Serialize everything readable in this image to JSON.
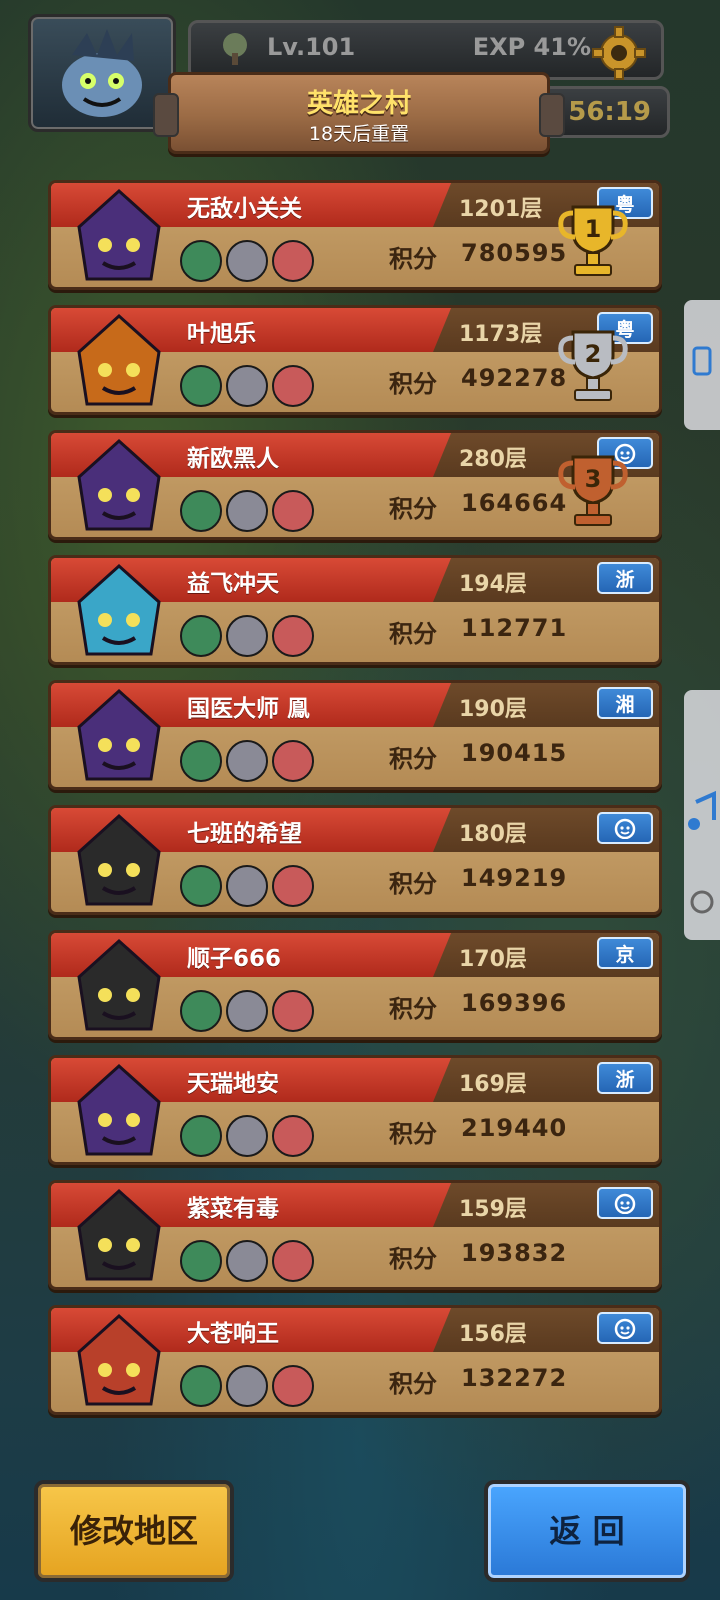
{
  "header": {
    "level": "Lv.101",
    "exp": "EXP 41%",
    "timer": "56:19",
    "banner_title": "英雄之村",
    "banner_subtitle": "18天后重置"
  },
  "leaderboard": {
    "score_label": "积分",
    "rows": [
      {
        "name": "无敌小关关",
        "floor": "1201层",
        "score": "780595",
        "region": "粤",
        "trophy": "gold"
      },
      {
        "name": "叶旭乐",
        "floor": "1173层",
        "score": "492278",
        "region": "粤",
        "trophy": "silver"
      },
      {
        "name": "新欧黑人",
        "floor": "280层",
        "score": "164664",
        "region": "",
        "trophy": "bronze"
      },
      {
        "name": "益飞冲天",
        "floor": "194层",
        "score": "112771",
        "region": "浙",
        "trophy": ""
      },
      {
        "name": "国医大师 鳯",
        "floor": "190层",
        "score": "190415",
        "region": "湘",
        "trophy": ""
      },
      {
        "name": "七班的希望",
        "floor": "180层",
        "score": "149219",
        "region": "",
        "trophy": ""
      },
      {
        "name": "顺子666",
        "floor": "170层",
        "score": "169396",
        "region": "京",
        "trophy": ""
      },
      {
        "name": "天瑞地安",
        "floor": "169层",
        "score": "219440",
        "region": "浙",
        "trophy": ""
      },
      {
        "name": "紫菜有毒",
        "floor": "159层",
        "score": "193832",
        "region": "",
        "trophy": ""
      },
      {
        "name": "大苍响王",
        "floor": "156层",
        "score": "132272",
        "region": "",
        "trophy": ""
      }
    ]
  },
  "buttons": {
    "change_region": "修改地区",
    "back": "返 回"
  },
  "colors": {
    "gold": "#e8b62a",
    "silver": "#b9bcc2",
    "bronze": "#c0602f",
    "region_blue": "#2f7ad0"
  }
}
